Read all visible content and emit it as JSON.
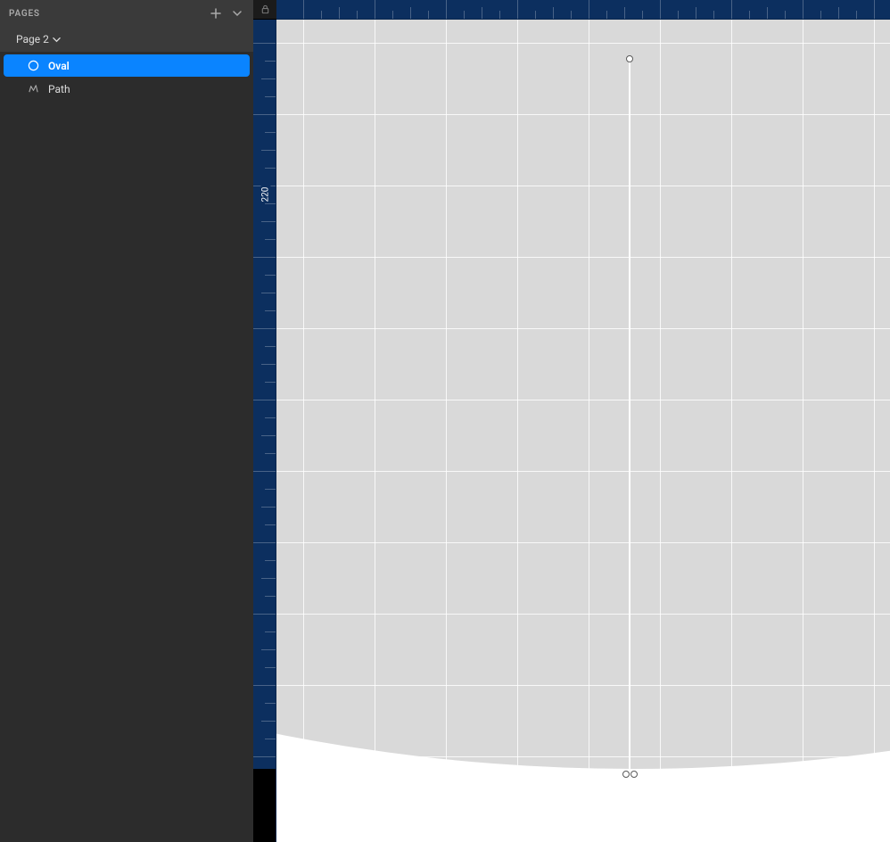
{
  "sidebar": {
    "header_title": "PAGES",
    "page_selector_label": "Page 2",
    "layers": [
      {
        "name": "Oval",
        "icon": "oval",
        "selected": true
      },
      {
        "name": "Path",
        "icon": "path",
        "selected": false
      }
    ]
  },
  "ruler": {
    "vertical_label": "220"
  }
}
